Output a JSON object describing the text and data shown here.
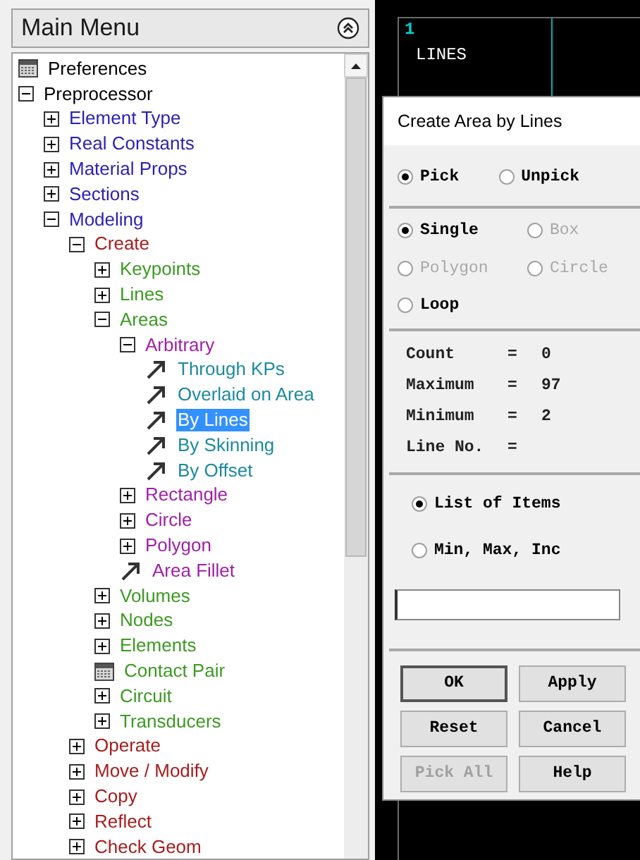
{
  "menu": {
    "title": "Main Menu",
    "tree": [
      {
        "label": "Preferences",
        "kind": "dialog",
        "color": "#000000",
        "selected": false
      },
      {
        "label": "Preprocessor",
        "kind": "folder",
        "expanded": true,
        "color": "#000000",
        "selected": false,
        "children": [
          {
            "label": "Element Type",
            "kind": "folder",
            "expanded": false,
            "color": "#2b1fb4",
            "selected": false
          },
          {
            "label": "Real Constants",
            "kind": "folder",
            "expanded": false,
            "color": "#2b1fb4",
            "selected": false
          },
          {
            "label": "Material Props",
            "kind": "folder",
            "expanded": false,
            "color": "#2b1fb4",
            "selected": false
          },
          {
            "label": "Sections",
            "kind": "folder",
            "expanded": false,
            "color": "#2b1fb4",
            "selected": false
          },
          {
            "label": "Modeling",
            "kind": "folder",
            "expanded": true,
            "color": "#2b1fb4",
            "selected": false,
            "children": [
              {
                "label": "Create",
                "kind": "folder",
                "expanded": true,
                "color": "#a81c1c",
                "selected": false,
                "children": [
                  {
                    "label": "Keypoints",
                    "kind": "folder",
                    "expanded": false,
                    "color": "#3c9a22",
                    "selected": false
                  },
                  {
                    "label": "Lines",
                    "kind": "folder",
                    "expanded": false,
                    "color": "#3c9a22",
                    "selected": false
                  },
                  {
                    "label": "Areas",
                    "kind": "folder",
                    "expanded": true,
                    "color": "#3c9a22",
                    "selected": false,
                    "children": [
                      {
                        "label": "Arbitrary",
                        "kind": "folder",
                        "expanded": true,
                        "color": "#a020a8",
                        "selected": false,
                        "children": [
                          {
                            "label": "Through KPs",
                            "kind": "action",
                            "color": "#1c8aa0",
                            "selected": false
                          },
                          {
                            "label": "Overlaid on Area",
                            "kind": "action",
                            "color": "#1c8aa0",
                            "selected": false
                          },
                          {
                            "label": "By Lines",
                            "kind": "action",
                            "selected": true
                          },
                          {
                            "label": "By Skinning",
                            "kind": "action",
                            "color": "#1c8aa0",
                            "selected": false
                          },
                          {
                            "label": "By Offset",
                            "kind": "action",
                            "color": "#1c8aa0",
                            "selected": false
                          }
                        ]
                      },
                      {
                        "label": "Rectangle",
                        "kind": "folder",
                        "expanded": false,
                        "color": "#a020a8",
                        "selected": false
                      },
                      {
                        "label": "Circle",
                        "kind": "folder",
                        "expanded": false,
                        "color": "#a020a8",
                        "selected": false
                      },
                      {
                        "label": "Polygon",
                        "kind": "folder",
                        "expanded": false,
                        "color": "#a020a8",
                        "selected": false
                      },
                      {
                        "label": "Area Fillet",
                        "kind": "action",
                        "color": "#a020a8",
                        "selected": false
                      }
                    ]
                  },
                  {
                    "label": "Volumes",
                    "kind": "folder",
                    "expanded": false,
                    "color": "#3c9a22",
                    "selected": false
                  },
                  {
                    "label": "Nodes",
                    "kind": "folder",
                    "expanded": false,
                    "color": "#3c9a22",
                    "selected": false
                  },
                  {
                    "label": "Elements",
                    "kind": "folder",
                    "expanded": false,
                    "color": "#3c9a22",
                    "selected": false
                  },
                  {
                    "label": "Contact Pair",
                    "kind": "dialog",
                    "color": "#3c9a22",
                    "selected": false
                  },
                  {
                    "label": "Circuit",
                    "kind": "folder",
                    "expanded": false,
                    "color": "#3c9a22",
                    "selected": false
                  },
                  {
                    "label": "Transducers",
                    "kind": "folder",
                    "expanded": false,
                    "color": "#3c9a22",
                    "selected": false
                  }
                ]
              },
              {
                "label": "Operate",
                "kind": "folder",
                "expanded": false,
                "color": "#a81c1c",
                "selected": false
              },
              {
                "label": "Move / Modify",
                "kind": "folder",
                "expanded": false,
                "color": "#a81c1c",
                "selected": false
              },
              {
                "label": "Copy",
                "kind": "folder",
                "expanded": false,
                "color": "#a81c1c",
                "selected": false
              },
              {
                "label": "Reflect",
                "kind": "folder",
                "expanded": false,
                "color": "#a81c1c",
                "selected": false
              },
              {
                "label": "Check Geom",
                "kind": "folder",
                "expanded": false,
                "color": "#a81c1c",
                "selected": false
              }
            ]
          }
        ]
      }
    ]
  },
  "graphics": {
    "window_number": "1",
    "label": "LINES"
  },
  "dialog": {
    "title": "Create Area by Lines",
    "pick_mode": [
      {
        "label": "Pick",
        "selected": true,
        "disabled": false
      },
      {
        "label": "Unpick",
        "selected": false,
        "disabled": false
      }
    ],
    "pick_shape": [
      {
        "label": "Single",
        "selected": true,
        "disabled": false
      },
      {
        "label": "Box",
        "selected": false,
        "disabled": true
      },
      {
        "label": "Polygon",
        "selected": false,
        "disabled": true
      },
      {
        "label": "Circle",
        "selected": false,
        "disabled": true
      },
      {
        "label": "Loop",
        "selected": false,
        "disabled": false
      }
    ],
    "stats": [
      {
        "label": "Count",
        "sign": "=",
        "value": "0"
      },
      {
        "label": "Maximum",
        "sign": "=",
        "value": "97"
      },
      {
        "label": "Minimum",
        "sign": "=",
        "value": "2"
      },
      {
        "label": "Line No.",
        "sign": "="
      }
    ],
    "entry_mode": [
      {
        "label": "List of Items",
        "selected": true
      },
      {
        "label": "Min, Max, Inc",
        "selected": false
      }
    ],
    "buttons": [
      {
        "label": "OK",
        "disabled": false,
        "default": true
      },
      {
        "label": "Apply",
        "disabled": false,
        "default": false
      },
      {
        "label": "Reset",
        "disabled": false,
        "default": false
      },
      {
        "label": "Cancel",
        "disabled": false,
        "default": false
      },
      {
        "label": "Pick All",
        "disabled": true,
        "default": false
      },
      {
        "label": "Help",
        "disabled": false,
        "default": false
      }
    ]
  }
}
